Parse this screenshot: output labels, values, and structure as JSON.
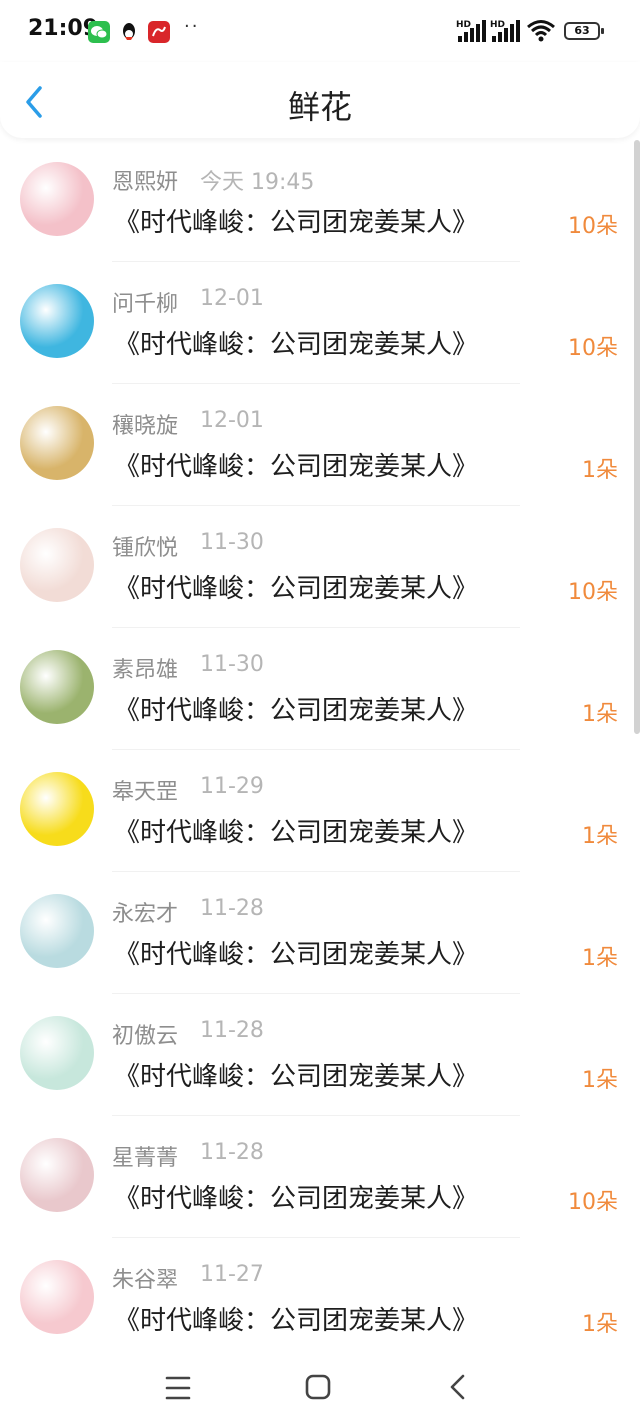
{
  "status_bar": {
    "time": "21:09",
    "dots": "··",
    "hd1": "HD",
    "hd2": "HD",
    "battery": "63"
  },
  "header": {
    "title": "鲜花",
    "back_icon": "chevron-left-icon"
  },
  "records": [
    {
      "name": "恩熙妍",
      "date": "今天 19:45",
      "book": "《时代峰峻：公司团宠姜某人》",
      "count": "10朵",
      "avatar_color": "#f4c1c9"
    },
    {
      "name": "问千柳",
      "date": "12-01",
      "book": "《时代峰峻：公司团宠姜某人》",
      "count": "10朵",
      "avatar_color": "#3fb6e0"
    },
    {
      "name": "穰晓旋",
      "date": "12-01",
      "book": "《时代峰峻：公司团宠姜某人》",
      "count": "1朵",
      "avatar_color": "#d8b46a"
    },
    {
      "name": "锺欣悦",
      "date": "11-30",
      "book": "《时代峰峻：公司团宠姜某人》",
      "count": "10朵",
      "avatar_color": "#f2dcd6"
    },
    {
      "name": "素昂雄",
      "date": "11-30",
      "book": "《时代峰峻：公司团宠姜某人》",
      "count": "1朵",
      "avatar_color": "#9bb36e"
    },
    {
      "name": "皋天罡",
      "date": "11-29",
      "book": "《时代峰峻：公司团宠姜某人》",
      "count": "1朵",
      "avatar_color": "#f7dc1b"
    },
    {
      "name": "永宏才",
      "date": "11-28",
      "book": "《时代峰峻：公司团宠姜某人》",
      "count": "1朵",
      "avatar_color": "#b9dbe0"
    },
    {
      "name": "初傲云",
      "date": "11-28",
      "book": "《时代峰峻：公司团宠姜某人》",
      "count": "1朵",
      "avatar_color": "#c7e7dc"
    },
    {
      "name": "星菁菁",
      "date": "11-28",
      "book": "《时代峰峻：公司团宠姜某人》",
      "count": "10朵",
      "avatar_color": "#e9c8cc"
    },
    {
      "name": "朱谷翠",
      "date": "11-27",
      "book": "《时代峰峻：公司团宠姜某人》",
      "count": "1朵",
      "avatar_color": "#f6c9cf"
    }
  ],
  "nav_bar": {
    "menu_icon": "menu-icon",
    "home_icon": "home-square-icon",
    "back_icon": "back-triangle-icon"
  },
  "colors": {
    "accent_blue": "#2b9de8",
    "count_orange": "#f08a3c",
    "name_gray": "#8e8e8e",
    "date_gray": "#b5b5b5"
  }
}
